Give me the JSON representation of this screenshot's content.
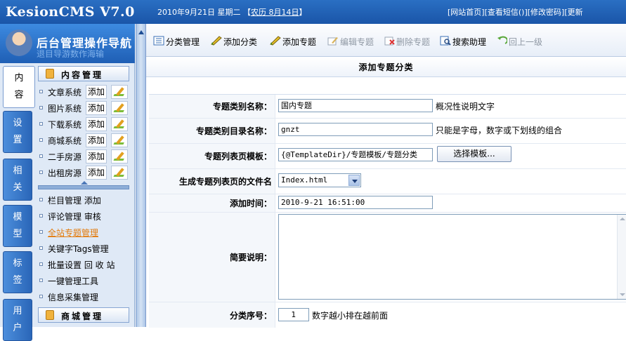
{
  "app": {
    "logo": "KesionCMS V7.0"
  },
  "header": {
    "date": "2010年9月21日 星期二",
    "lunar_open": "【",
    "lunar": "农历 8月14日",
    "lunar_close": "】",
    "links": "[网站首页][查看短信()][修改密码][更新"
  },
  "nav": {
    "title": "后台管理操作导航",
    "ghost": "退目导游数作海输",
    "vertical_tabs": [
      {
        "label": "内容",
        "active": true
      },
      {
        "label": "设置"
      },
      {
        "label": "相关"
      },
      {
        "label": "模型"
      },
      {
        "label": "标签"
      },
      {
        "label": "用户"
      }
    ],
    "content_section": "内容管理",
    "systems": [
      {
        "label": "文章系统",
        "add": "添加"
      },
      {
        "label": "图片系统",
        "add": "添加"
      },
      {
        "label": "下载系统",
        "add": "添加"
      },
      {
        "label": "商城系统",
        "add": "添加"
      },
      {
        "label": "二手房源",
        "add": "添加"
      },
      {
        "label": "出租房源",
        "add": "添加"
      }
    ],
    "links": [
      "栏目管理 添加",
      "评论管理 审核",
      "全站专题管理",
      "关键字Tags管理",
      "批量设置 回 收 站",
      "一键管理工具",
      "信息采集管理"
    ],
    "shop_section": "商城管理"
  },
  "toolbar": {
    "items": [
      "分类管理",
      "添加分类",
      "添加专题",
      "编辑专题",
      "删除专题",
      "搜索助理",
      "回上一级"
    ]
  },
  "page": {
    "title": "添加专题分类"
  },
  "form": {
    "name_label": "专题类别名称：",
    "name_value": "国内专题",
    "name_hint": "概况性说明文字",
    "dir_label": "专题类别目录名称：",
    "dir_value": "gnzt",
    "dir_hint": "只能是字母，数字或下划线的组合",
    "tpl_label": "专题列表页模板：",
    "tpl_value": "{@TemplateDir}/专题模板/专题分类",
    "tpl_button": "选择模板...",
    "file_label": "生成专题列表页的文件名",
    "file_value": "Index.html",
    "time_label": "添加时间：",
    "time_value": "2010-9-21 16:51:00",
    "desc_label": "简要说明：",
    "order_label": "分类序号：",
    "order_value": "1",
    "order_hint": "数字越小排在越前面"
  }
}
